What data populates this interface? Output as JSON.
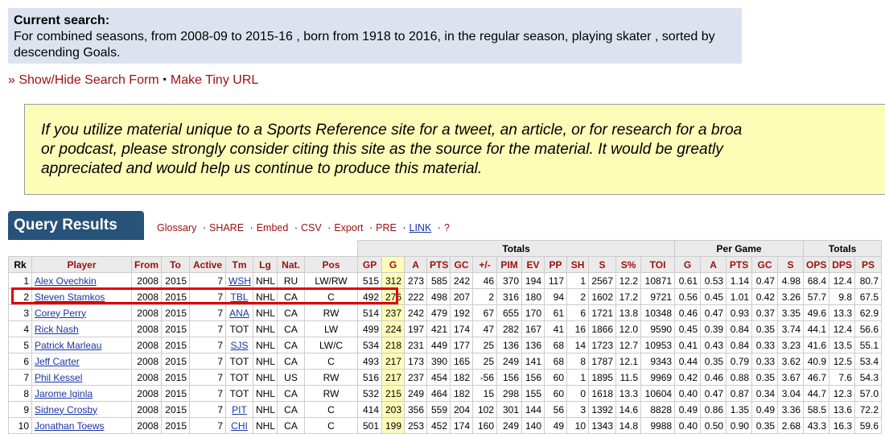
{
  "current_search": {
    "title": "Current search:",
    "text": "For combined seasons, from 2008-09 to 2015-16 , born from 1918 to 2016, in the regular season, playing skater , sorted by descending Goals."
  },
  "links": {
    "show_hide": "» Show/Hide Search Form",
    "separator": "▪",
    "tiny_url": "Make Tiny URL"
  },
  "notice": {
    "line1": "If you utilize material unique to a Sports Reference site for a tweet, an article, or for research for a broa",
    "line2": "or podcast, please strongly consider citing this site as the source for the material. It would be greatly",
    "line3": "appreciated and would help us continue to produce this material."
  },
  "query_results": {
    "title": "Query Results",
    "links": [
      "Glossary",
      "SHARE",
      "Embed",
      "CSV",
      "Export",
      "PRE",
      "LINK",
      "?"
    ],
    "link_sep": "·"
  },
  "table": {
    "group_headers": {
      "totals1": "Totals",
      "per_game": "Per Game",
      "totals2": "Totals"
    },
    "columns": [
      "Rk",
      "Player",
      "From",
      "To",
      "Active",
      "Tm",
      "Lg",
      "Nat.",
      "Pos",
      "GP",
      "G",
      "A",
      "PTS",
      "GC",
      "+/-",
      "PIM",
      "EV",
      "PP",
      "SH",
      "S",
      "S%",
      "TOI",
      "G",
      "A",
      "PTS",
      "GC",
      "S",
      "OPS",
      "DPS",
      "PS"
    ],
    "rows": [
      [
        "1",
        "Alex Ovechkin",
        "2008",
        "2015",
        "7",
        "WSH",
        "NHL",
        "RU",
        "LW/RW",
        "515",
        "312",
        "273",
        "585",
        "242",
        "46",
        "370",
        "194",
        "117",
        "1",
        "2567",
        "12.2",
        "10871",
        "0.61",
        "0.53",
        "1.14",
        "0.47",
        "4.98",
        "68.4",
        "12.4",
        "80.7"
      ],
      [
        "2",
        "Steven Stamkos",
        "2008",
        "2015",
        "7",
        "TBL",
        "NHL",
        "CA",
        "C",
        "492",
        "276",
        "222",
        "498",
        "207",
        "2",
        "316",
        "180",
        "94",
        "2",
        "1602",
        "17.2",
        "9721",
        "0.56",
        "0.45",
        "1.01",
        "0.42",
        "3.26",
        "57.7",
        "9.8",
        "67.5"
      ],
      [
        "3",
        "Corey Perry",
        "2008",
        "2015",
        "7",
        "ANA",
        "NHL",
        "CA",
        "RW",
        "514",
        "237",
        "242",
        "479",
        "192",
        "67",
        "655",
        "170",
        "61",
        "6",
        "1721",
        "13.8",
        "10348",
        "0.46",
        "0.47",
        "0.93",
        "0.37",
        "3.35",
        "49.6",
        "13.3",
        "62.9"
      ],
      [
        "4",
        "Rick Nash",
        "2008",
        "2015",
        "7",
        "TOT",
        "NHL",
        "CA",
        "LW",
        "499",
        "224",
        "197",
        "421",
        "174",
        "47",
        "282",
        "167",
        "41",
        "16",
        "1866",
        "12.0",
        "9590",
        "0.45",
        "0.39",
        "0.84",
        "0.35",
        "3.74",
        "44.1",
        "12.4",
        "56.6"
      ],
      [
        "5",
        "Patrick Marleau",
        "2008",
        "2015",
        "7",
        "SJS",
        "NHL",
        "CA",
        "LW/C",
        "534",
        "218",
        "231",
        "449",
        "177",
        "25",
        "136",
        "136",
        "68",
        "14",
        "1723",
        "12.7",
        "10953",
        "0.41",
        "0.43",
        "0.84",
        "0.33",
        "3.23",
        "41.6",
        "13.5",
        "55.1"
      ],
      [
        "6",
        "Jeff Carter",
        "2008",
        "2015",
        "7",
        "TOT",
        "NHL",
        "CA",
        "C",
        "493",
        "217",
        "173",
        "390",
        "165",
        "25",
        "249",
        "141",
        "68",
        "8",
        "1787",
        "12.1",
        "9343",
        "0.44",
        "0.35",
        "0.79",
        "0.33",
        "3.62",
        "40.9",
        "12.5",
        "53.4"
      ],
      [
        "7",
        "Phil Kessel",
        "2008",
        "2015",
        "7",
        "TOT",
        "NHL",
        "US",
        "RW",
        "516",
        "217",
        "237",
        "454",
        "182",
        "-56",
        "156",
        "156",
        "60",
        "1",
        "1895",
        "11.5",
        "9969",
        "0.42",
        "0.46",
        "0.88",
        "0.35",
        "3.67",
        "46.7",
        "7.6",
        "54.3"
      ],
      [
        "8",
        "Jarome Iginla",
        "2008",
        "2015",
        "7",
        "TOT",
        "NHL",
        "CA",
        "RW",
        "532",
        "215",
        "249",
        "464",
        "182",
        "15",
        "298",
        "155",
        "60",
        "0",
        "1618",
        "13.3",
        "10604",
        "0.40",
        "0.47",
        "0.87",
        "0.34",
        "3.04",
        "44.7",
        "12.3",
        "57.0"
      ],
      [
        "9",
        "Sidney Crosby",
        "2008",
        "2015",
        "7",
        "PIT",
        "NHL",
        "CA",
        "C",
        "414",
        "203",
        "356",
        "559",
        "204",
        "102",
        "301",
        "144",
        "56",
        "3",
        "1392",
        "14.6",
        "8828",
        "0.49",
        "0.86",
        "1.35",
        "0.49",
        "3.36",
        "58.5",
        "13.6",
        "72.2"
      ],
      [
        "10",
        "Jonathan Toews",
        "2008",
        "2015",
        "7",
        "CHI",
        "NHL",
        "CA",
        "C",
        "501",
        "199",
        "253",
        "452",
        "174",
        "160",
        "249",
        "140",
        "49",
        "10",
        "1343",
        "14.8",
        "9988",
        "0.40",
        "0.50",
        "0.90",
        "0.35",
        "2.68",
        "43.3",
        "16.3",
        "59.6"
      ]
    ],
    "linked_teams": [
      "WSH",
      "TBL",
      "ANA",
      "SJS",
      "PIT",
      "CHI"
    ],
    "highlight_row": 2,
    "colors": {
      "link": "#1a33a6",
      "header_link": "#9c0f0f",
      "highlight": "#fefdb8",
      "box": "#e00000",
      "tab": "#27537a"
    }
  }
}
